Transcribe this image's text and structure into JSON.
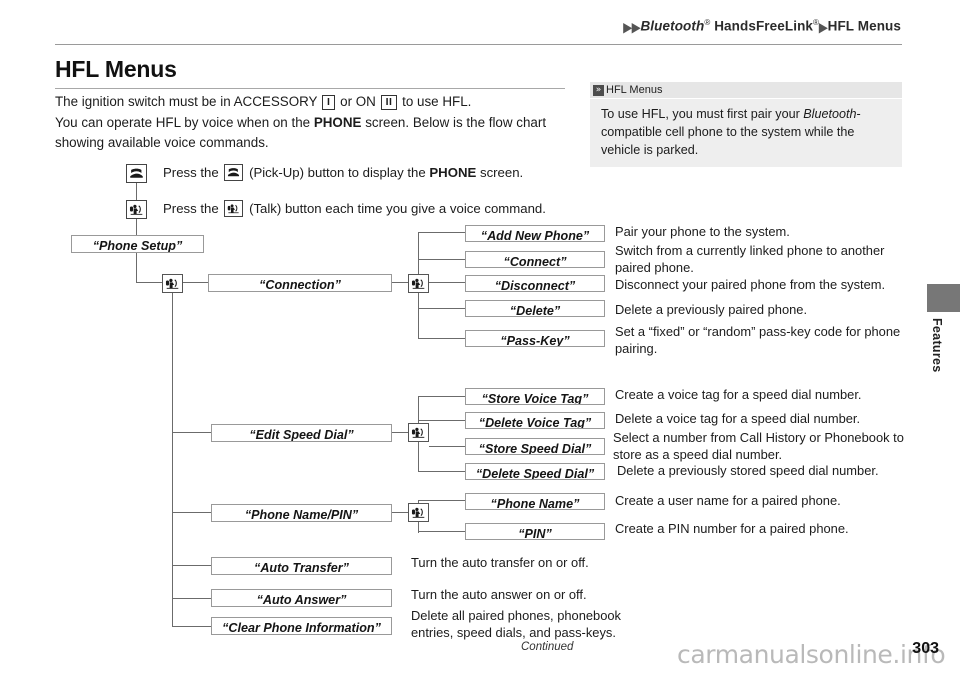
{
  "header": {
    "breadcrumb_arrow": "▶",
    "crumb1": "Bluetooth",
    "crumb1_sup": "®",
    "crumb2": "HandsFreeLink",
    "crumb2_sup": "®",
    "crumb3": "HFL Menus"
  },
  "title": "HFL Menus",
  "intro": {
    "line1_a": "The ignition switch must be in ACCESSORY",
    "key_accessory": "I",
    "line1_b": "or ON",
    "key_on": "II",
    "line1_c": "to use HFL.",
    "line2_a": "You can operate HFL by voice when on the",
    "line2_bold": "PHONE",
    "line2_b": "screen. Below is the flow chart showing available voice commands."
  },
  "note": {
    "chevron": "»",
    "heading": "HFL Menus",
    "body_a": "To use HFL, you must first pair your ",
    "body_italic": "Bluetooth",
    "body_b": "-compatible cell phone to the system while the vehicle is parked."
  },
  "side_tab": {
    "label": "Features"
  },
  "legend": [
    {
      "icon": "pickup-icon",
      "text_a": "Press the",
      "text_b": "(Pick-Up) button to display the",
      "bold": "PHONE",
      "text_c": "screen."
    },
    {
      "icon": "talk-icon",
      "text_a": "Press the",
      "text_b": "(Talk) button each time you give a voice command.",
      "bold": "",
      "text_c": ""
    }
  ],
  "flow": {
    "root": "“Phone Setup”",
    "branches": [
      {
        "label": "“Connection”",
        "children": [
          {
            "label": "“Add New Phone”",
            "desc": "Pair your phone to the system."
          },
          {
            "label": "“Connect”",
            "desc": "Switch from a currently linked phone to another paired phone."
          },
          {
            "label": "“Disconnect”",
            "desc": "Disconnect your paired phone from the system."
          },
          {
            "label": "“Delete”",
            "desc": "Delete a previously paired phone."
          },
          {
            "label": "“Pass-Key”",
            "desc": "Set a “fixed” or “random” pass-key code for phone pairing."
          }
        ]
      },
      {
        "label": "“Edit Speed Dial”",
        "children": [
          {
            "label": "“Store Voice Tag”",
            "desc": "Create a voice tag for a speed dial number."
          },
          {
            "label": "“Delete Voice Tag”",
            "desc": "Delete a voice tag for a speed dial number."
          },
          {
            "label": "“Store Speed Dial”",
            "desc": "Select a number from Call History or Phonebook to store as a speed dial number."
          },
          {
            "label": "“Delete Speed Dial”",
            "desc": "Delete a previously stored speed dial number."
          }
        ]
      },
      {
        "label": "“Phone Name/PIN”",
        "children": [
          {
            "label": "“Phone Name”",
            "desc": "Create a user name for a paired phone."
          },
          {
            "label": "“PIN”",
            "desc": "Create a PIN number for a paired phone."
          }
        ]
      }
    ],
    "leaves": [
      {
        "label": "“Auto Transfer”",
        "desc": "Turn the auto transfer on or off."
      },
      {
        "label": "“Auto Answer”",
        "desc": "Turn the auto answer on or off."
      },
      {
        "label": "“Clear Phone Information”",
        "desc": "Delete all paired phones, phonebook entries, speed dials, and pass-keys."
      }
    ]
  },
  "footer": {
    "continued": "Continued",
    "page_number": "303",
    "watermark": "carmanualsonline.info"
  }
}
